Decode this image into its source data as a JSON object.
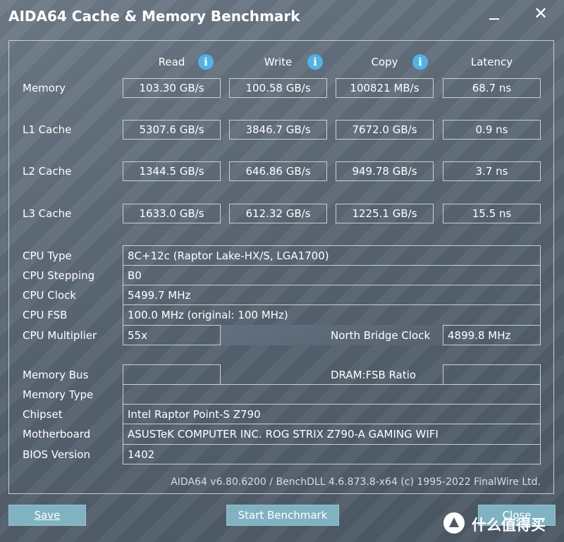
{
  "window": {
    "title": "AIDA64 Cache & Memory Benchmark",
    "close_glyph": "✕"
  },
  "columns": [
    "Read",
    "Write",
    "Copy",
    "Latency"
  ],
  "info_glyph": "i",
  "rows": [
    {
      "label": "Memory",
      "values": [
        "103.30 GB/s",
        "100.58 GB/s",
        "100821 MB/s",
        "68.7 ns"
      ]
    },
    {
      "label": "L1 Cache",
      "values": [
        "5307.6 GB/s",
        "3846.7 GB/s",
        "7672.0 GB/s",
        "0.9 ns"
      ]
    },
    {
      "label": "L2 Cache",
      "values": [
        "1344.5 GB/s",
        "646.86 GB/s",
        "949.78 GB/s",
        "3.7 ns"
      ]
    },
    {
      "label": "L3 Cache",
      "values": [
        "1633.0 GB/s",
        "612.32 GB/s",
        "1225.1 GB/s",
        "15.5 ns"
      ]
    }
  ],
  "cpu": {
    "type_label": "CPU Type",
    "type_value": "8C+12c   (Raptor Lake-HX/S, LGA1700)",
    "stepping_label": "CPU Stepping",
    "stepping_value": "B0",
    "clock_label": "CPU Clock",
    "clock_value": "5499.7 MHz",
    "fsb_label": "CPU FSB",
    "fsb_value": "100.0 MHz  (original: 100 MHz)",
    "multiplier_label": "CPU Multiplier",
    "multiplier_value": "55x",
    "nb_clock_label": "North Bridge Clock",
    "nb_clock_value": "4899.8 MHz"
  },
  "memory": {
    "bus_label": "Memory Bus",
    "bus_value": "",
    "ratio_label": "DRAM:FSB Ratio",
    "ratio_value": "",
    "type_label": "Memory Type",
    "type_value": "",
    "chipset_label": "Chipset",
    "chipset_value": "Intel Raptor Point-S Z790",
    "motherboard_label": "Motherboard",
    "motherboard_value": "ASUSTeK COMPUTER INC. ROG STRIX Z790-A GAMING WIFI",
    "bios_label": "BIOS Version",
    "bios_value": "1402"
  },
  "footer": "AIDA64 v6.80.6200 / BenchDLL 4.6.873.8-x64  (c) 1995-2022 FinalWire Ltd.",
  "buttons": {
    "save": "Save",
    "start": "Start Benchmark",
    "close": "Close"
  },
  "watermark": {
    "text": "什么值得买"
  }
}
